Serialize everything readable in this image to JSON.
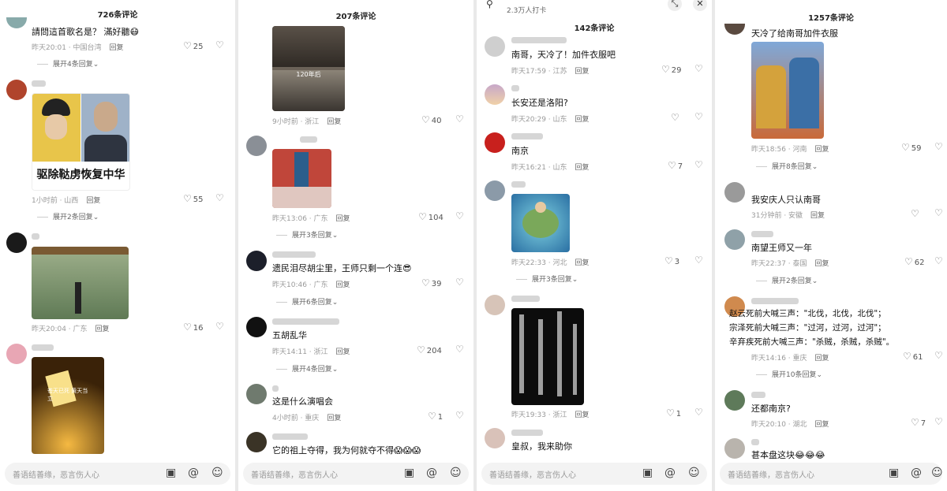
{
  "panels": [
    {
      "count_label": "726条评论",
      "comments": [
        {
          "text": "請問這首歌名是？ 滿好聽😷",
          "meta": "昨天20:01 · 中国台湾",
          "reply": "回复",
          "likes": "25",
          "expand": ""
        },
        {
          "text": "",
          "image_caption": "驱除鞑虏恢复中华",
          "meta": "1小时前 · 山西",
          "reply": "回复",
          "likes": "55",
          "expand": "展开2条回复⌄"
        },
        {
          "text": "",
          "meta": "昨天20:04 · 广东",
          "reply": "回复",
          "likes": "16",
          "expand": ""
        },
        {
          "text": "",
          "image_caption": "苍天已死 黄天当立",
          "meta": "",
          "reply": "",
          "likes": "",
          "expand": ""
        }
      ],
      "expand_first": "展开4条回复⌄",
      "input_placeholder": "善语结善缘，恶言伤人心"
    },
    {
      "count_label": "207条评论",
      "comments": [
        {
          "text": "",
          "image_caption": "120年后",
          "meta": "9小时前 · 浙江",
          "reply": "回复",
          "likes": "40",
          "expand": ""
        },
        {
          "text": "",
          "meta": "昨天13:06 · 广东",
          "reply": "回复",
          "likes": "104",
          "expand": "展开3条回复⌄"
        },
        {
          "text": "遗民泪尽胡尘里，王师只剩一个连😎",
          "meta": "昨天10:46 · 广东",
          "reply": "回复",
          "likes": "39",
          "expand": "展开6条回复⌄"
        },
        {
          "text": "五胡乱华",
          "meta": "昨天14:11 · 浙江",
          "reply": "回复",
          "likes": "204",
          "expand": "展开4条回复⌄"
        },
        {
          "text": "这是什么演唱会",
          "meta": "4小时前 · 重庆",
          "reply": "回复",
          "likes": "1",
          "expand": ""
        },
        {
          "text": "它的祖上夺得，我为何就夺不得😱😱😱",
          "meta": "",
          "reply": "",
          "likes": "",
          "expand": ""
        }
      ],
      "input_placeholder": "善语结善缘，恶言伤人心"
    },
    {
      "count_label": "142条评论",
      "top_sub": "2.3万人打卡",
      "comments": [
        {
          "text": "南哥，天冷了！加件衣服吧",
          "meta": "昨天17:59 · 江苏",
          "reply": "回复",
          "likes": "29",
          "expand": ""
        },
        {
          "text": "长安还是洛阳?",
          "meta": "昨天20:29 · 山东",
          "reply": "回复",
          "likes": "",
          "expand": ""
        },
        {
          "text": "南京",
          "meta": "昨天16:21 · 山东",
          "reply": "回复",
          "likes": "7",
          "expand": ""
        },
        {
          "text": "",
          "meta": "昨天22:33 · 河北",
          "reply": "回复",
          "likes": "3",
          "expand": "展开3条回复⌄"
        },
        {
          "text": "",
          "meta": "昨天19:33 · 浙江",
          "reply": "回复",
          "likes": "1",
          "expand": ""
        },
        {
          "text": "皇叔，我来助你",
          "meta": "",
          "reply": "",
          "likes": "",
          "expand": ""
        }
      ],
      "input_placeholder": "善语结善缘，恶言伤人心"
    },
    {
      "count_label": "1257条评论",
      "comments": [
        {
          "text": "天冷了给南哥加件衣服",
          "meta": "昨天18:56 · 河南",
          "reply": "回复",
          "likes": "59",
          "expand": "展开8条回复⌄"
        },
        {
          "text": "我安庆人只认南哥",
          "meta": "31分钟前 · 安徽",
          "reply": "回复",
          "likes": "",
          "expand": ""
        },
        {
          "text": "南望王师又一年",
          "meta": "昨天22:37 · 泰国",
          "reply": "回复",
          "likes": "62",
          "expand": "展开2条回复⌄"
        },
        {
          "text": "赵云死前大喊三声：\"北伐，北伐，北伐\"；",
          "text2": "宗泽死前大喊三声：\"过河，过河，过河\"；",
          "text3": "辛弃疾死前大喊三声：\"杀贼，杀贼，杀贼\"。",
          "meta": "昨天14:16 · 重庆",
          "reply": "回复",
          "likes": "61",
          "expand": "展开10条回复⌄"
        },
        {
          "text": "还都南京?",
          "meta": "昨天20:10 · 湖北",
          "reply": "回复",
          "likes": "7",
          "expand": ""
        },
        {
          "text": "甚本盘这块😂😂😂",
          "meta": "",
          "reply": "",
          "likes": "",
          "expand": ""
        }
      ],
      "input_placeholder": "善语结善缘，恶言伤人心"
    }
  ]
}
